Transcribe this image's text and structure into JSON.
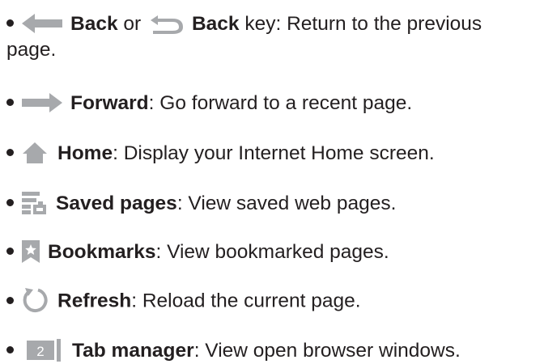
{
  "items": [
    {
      "name": "back",
      "label": "Back",
      "or_text": " or ",
      "label2": "Back",
      "rest": " key: Return to the previous",
      "rest2": "page."
    },
    {
      "name": "forward",
      "label": "Forward",
      "rest": ": Go forward to a recent page."
    },
    {
      "name": "home",
      "label": "Home",
      "rest": ": Display your Internet Home screen."
    },
    {
      "name": "saved-pages",
      "label": "Saved pages",
      "rest": ": View saved web pages."
    },
    {
      "name": "bookmarks",
      "label": "Bookmarks",
      "rest": ": View bookmarked pages."
    },
    {
      "name": "refresh",
      "label": "Refresh",
      "rest": ": Reload the current page."
    },
    {
      "name": "tab-manager",
      "label": "Tab manager",
      "rest": ": View open browser windows.",
      "icon_text": "2"
    }
  ],
  "colors": {
    "icon": "#a7a9ac",
    "text": "#231f20"
  }
}
